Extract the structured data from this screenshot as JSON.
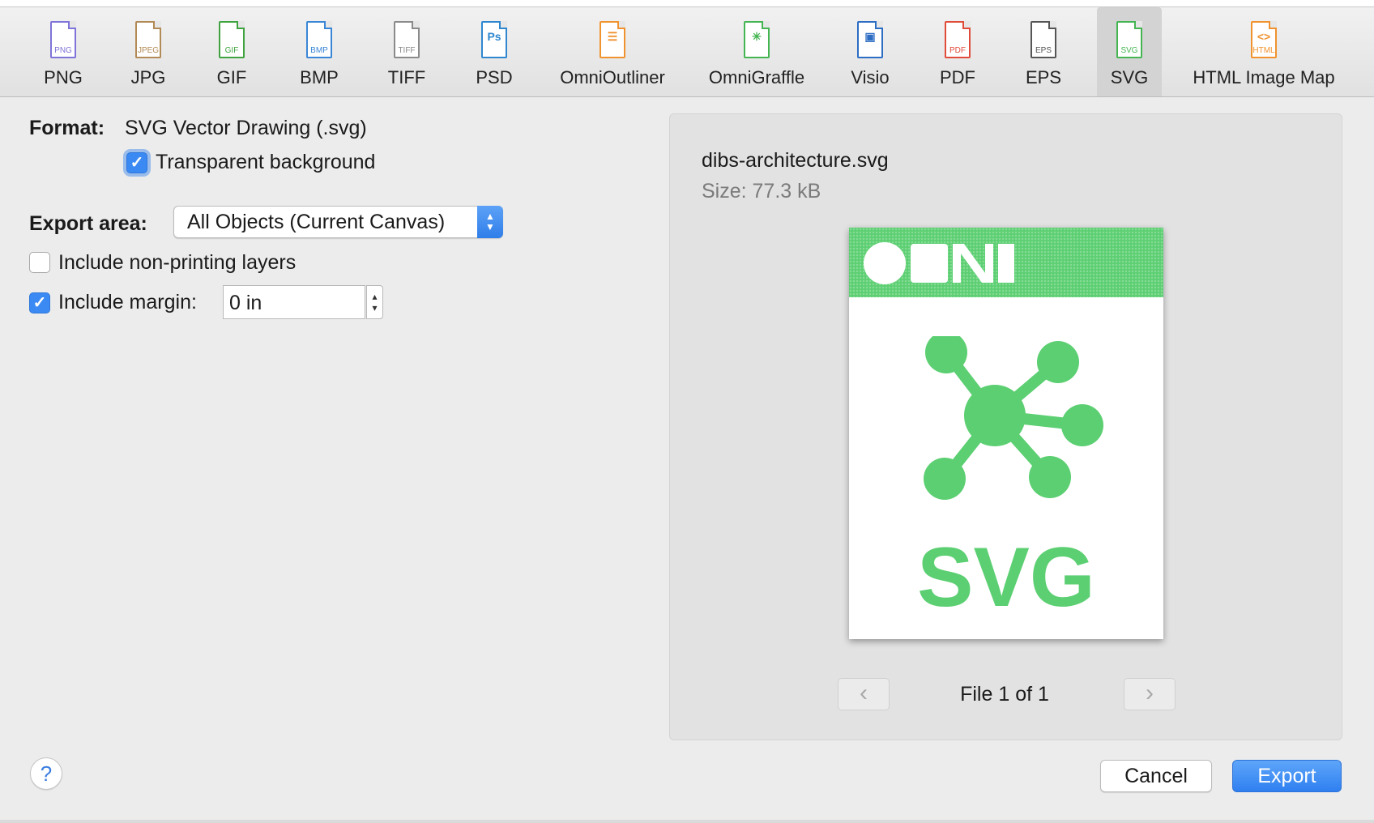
{
  "toolbar": {
    "items": [
      {
        "label": "PNG",
        "tag": "PNG",
        "glyph": "",
        "icon": "png-file-icon",
        "color": "#7f74d9"
      },
      {
        "label": "JPG",
        "tag": "JPEG",
        "glyph": "",
        "icon": "jpeg-file-icon",
        "color": "#b28a56"
      },
      {
        "label": "GIF",
        "tag": "GIF",
        "glyph": "",
        "icon": "gif-file-icon",
        "color": "#3fa33f"
      },
      {
        "label": "BMP",
        "tag": "BMP",
        "glyph": "",
        "icon": "bmp-file-icon",
        "color": "#3a86d6"
      },
      {
        "label": "TIFF",
        "tag": "TIFF",
        "glyph": "",
        "icon": "tiff-file-icon",
        "color": "#8a8a8a"
      },
      {
        "label": "PSD",
        "tag": "",
        "glyph": "Ps",
        "icon": "photoshop-file-icon",
        "color": "#2f87d0"
      },
      {
        "label": "OmniOutliner",
        "tag": "",
        "glyph": "☰",
        "icon": "omnioutliner-file-icon",
        "color": "#f0932f"
      },
      {
        "label": "OmniGraffle",
        "tag": "",
        "glyph": "✳",
        "icon": "omnigraffle-file-icon",
        "color": "#45b552"
      },
      {
        "label": "Visio",
        "tag": "",
        "glyph": "▣",
        "icon": "visio-file-icon",
        "color": "#2d6dc4"
      },
      {
        "label": "PDF",
        "tag": "PDF",
        "glyph": "",
        "icon": "pdf-file-icon",
        "color": "#e04b3a"
      },
      {
        "label": "EPS",
        "tag": "EPS",
        "glyph": "",
        "icon": "eps-file-icon",
        "color": "#555555"
      },
      {
        "label": "SVG",
        "tag": "SVG",
        "glyph": "",
        "icon": "svg-file-icon",
        "color": "#45b552"
      },
      {
        "label": "HTML Image Map",
        "tag": "HTML",
        "glyph": "<>",
        "icon": "html-file-icon",
        "color": "#f0932f"
      }
    ],
    "selected": "SVG"
  },
  "options": {
    "format_label": "Format:",
    "format_value": "SVG Vector Drawing (.svg)",
    "transparent_label": "Transparent background",
    "transparent_checked": true,
    "export_area_label": "Export area:",
    "export_area_value": "All Objects (Current Canvas)",
    "nonprinting_label": "Include non-printing layers",
    "nonprinting_checked": false,
    "margin_label": "Include margin:",
    "margin_checked": true,
    "margin_value": "0 in"
  },
  "preview": {
    "filename": "dibs-architecture.svg",
    "size": "Size: 77.3 kB",
    "thumbnail_text": "SVG",
    "thumbnail_brand": "OMNI",
    "file_count": "File 1 of 1",
    "prev": "‹",
    "next": "›"
  },
  "buttons": {
    "help": "?",
    "cancel": "Cancel",
    "export": "Export"
  },
  "colors": {
    "accent": "#3b8af3",
    "svg_green": "#5ccf72"
  }
}
